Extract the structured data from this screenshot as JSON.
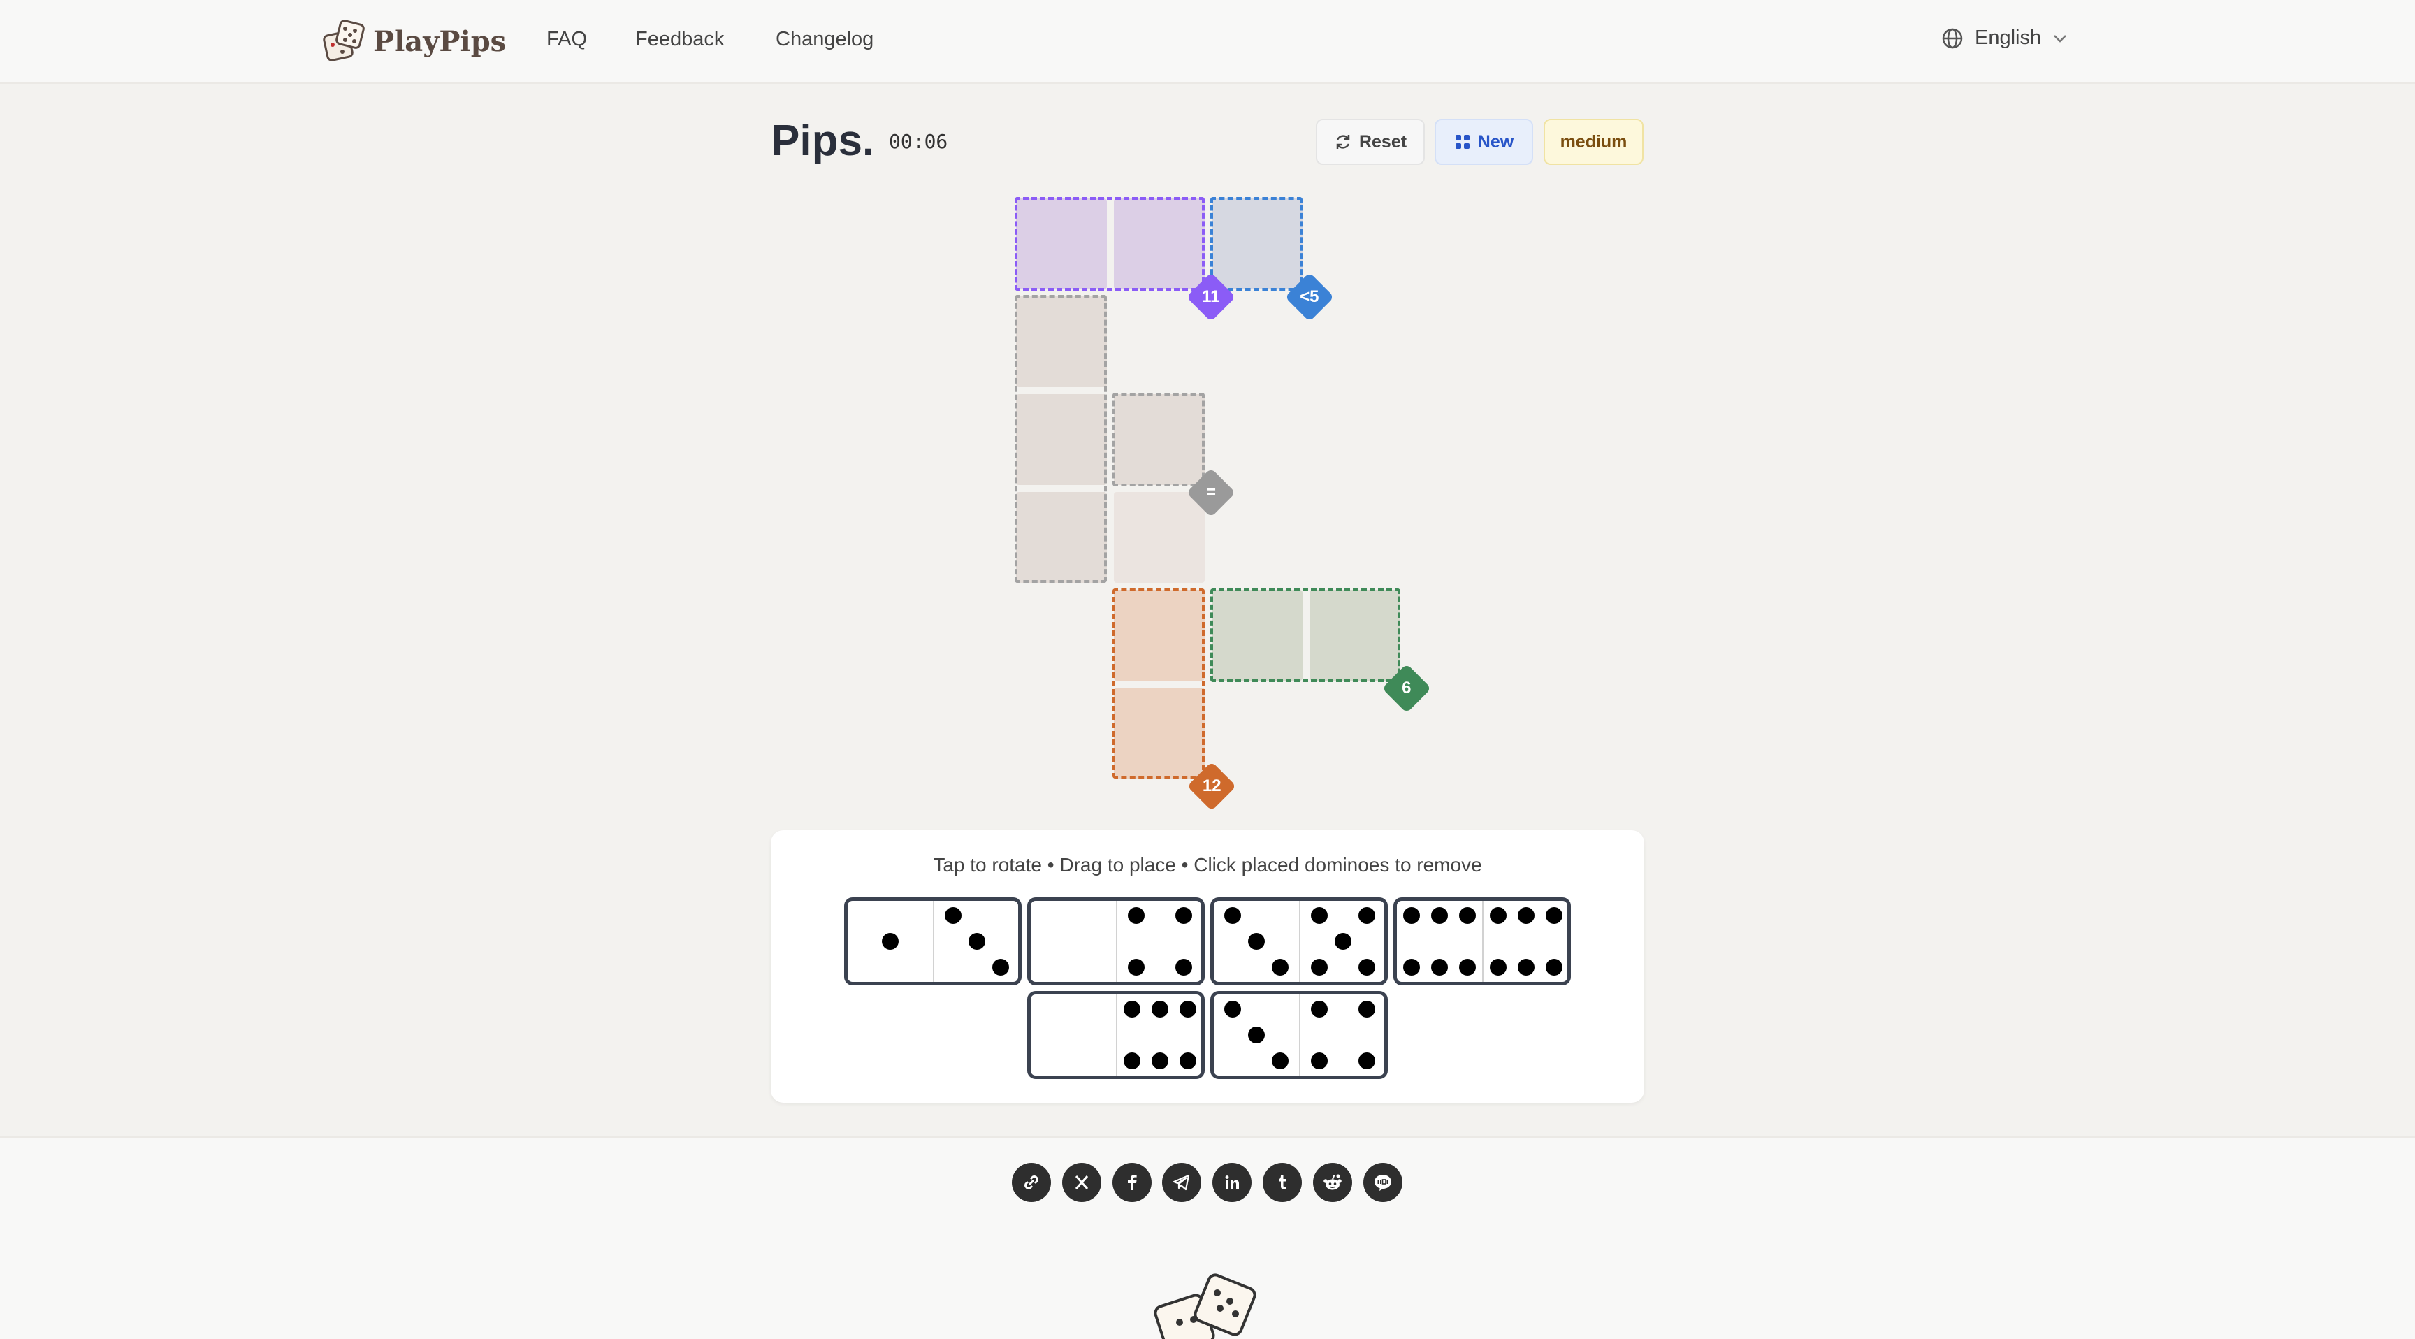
{
  "header": {
    "brand": "PlayPips",
    "nav": [
      "FAQ",
      "Feedback",
      "Changelog"
    ],
    "language": "English",
    "icons": {
      "language": "globe-icon",
      "language_caret": "chevron-down-icon"
    }
  },
  "game": {
    "title": "Pips.",
    "timer": "00:06",
    "reset_label": "Reset",
    "new_label": "New",
    "difficulty": "medium"
  },
  "board": {
    "constraints": [
      {
        "label": "11",
        "color": "#8b5cf6"
      },
      {
        "label": "<5",
        "color": "#3b82d6"
      },
      {
        "label": "=",
        "color": "#9a9a9a"
      },
      {
        "label": "6",
        "color": "#3f8a58"
      },
      {
        "label": "12",
        "color": "#cf6a2c"
      }
    ]
  },
  "tray": {
    "hint": "Tap to rotate • Drag to place • Click placed dominoes to remove",
    "dominoes": [
      [
        1,
        3
      ],
      [
        0,
        4
      ],
      [
        3,
        5
      ],
      [
        6,
        6
      ],
      [
        0,
        6
      ],
      [
        3,
        4
      ]
    ]
  },
  "footer": {
    "share": [
      "link-icon",
      "x-icon",
      "facebook-icon",
      "telegram-icon",
      "linkedin-icon",
      "tumblr-icon",
      "reddit-icon",
      "line-icon"
    ]
  }
}
